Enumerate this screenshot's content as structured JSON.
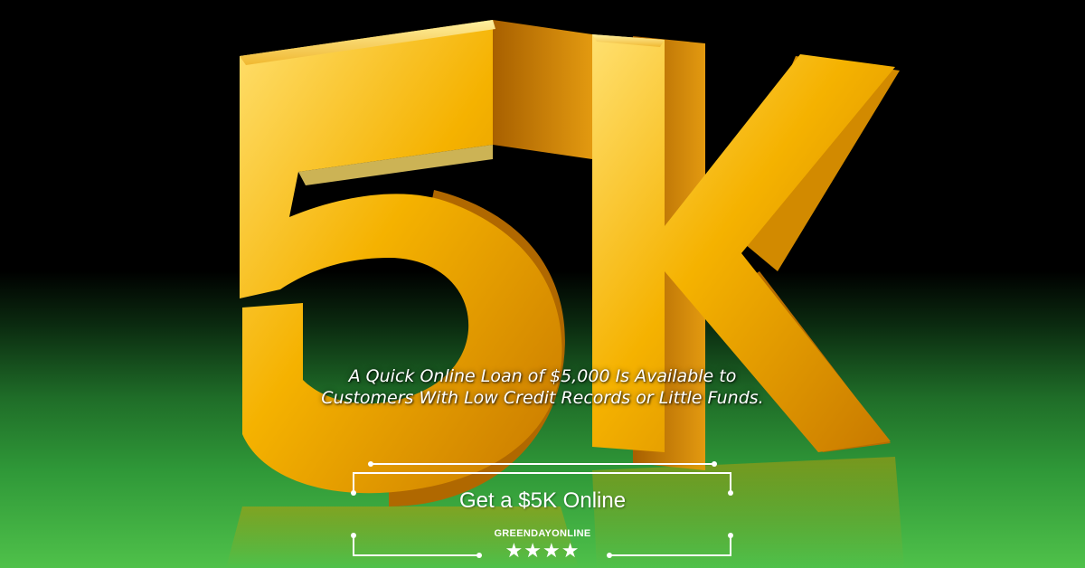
{
  "banner": {
    "hero_glyphs": "5K",
    "tagline": "A Quick Online Loan of $5,000 Is Available to Customers With Low Credit Records or Little Funds.",
    "cta_label": "Get a $5K Online",
    "brand_name": "GREENDAYONLINE",
    "stars": "★★★★",
    "rating": 4
  },
  "colors": {
    "background_top": "#000000",
    "background_bottom": "#4fc14a",
    "gold_light": "#ffd24a",
    "gold_mid": "#f2a500",
    "gold_dark": "#b36a00",
    "frame_line": "#ffffff"
  }
}
